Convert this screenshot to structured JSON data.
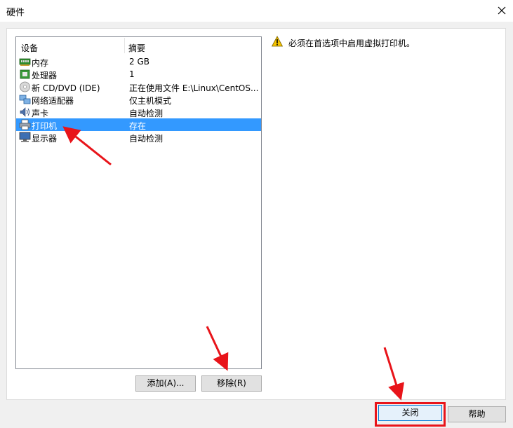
{
  "window": {
    "title": "硬件"
  },
  "device_list": {
    "columns": {
      "device": "设备",
      "summary": "摘要"
    },
    "rows": [
      {
        "name": "内存",
        "summary": "2 GB",
        "icon": "memory-icon",
        "selected": false
      },
      {
        "name": "处理器",
        "summary": "1",
        "icon": "cpu-icon",
        "selected": false
      },
      {
        "name": "新 CD/DVD (IDE)",
        "summary": "正在使用文件 E:\\Linux\\CentOS...",
        "icon": "cd-dvd-icon",
        "selected": false
      },
      {
        "name": "网络适配器",
        "summary": "仅主机模式",
        "icon": "network-adapter-icon",
        "selected": false
      },
      {
        "name": "声卡",
        "summary": "自动检测",
        "icon": "sound-card-icon",
        "selected": false
      },
      {
        "name": "打印机",
        "summary": "存在",
        "icon": "printer-icon",
        "selected": true
      },
      {
        "name": "显示器",
        "summary": "自动检测",
        "icon": "display-icon",
        "selected": false
      }
    ]
  },
  "buttons": {
    "add": "添加(A)...",
    "remove": "移除(R)",
    "close": "关闭",
    "help": "帮助"
  },
  "message": {
    "icon": "warning-icon",
    "text": "必须在首选项中启用虚拟打印机。"
  },
  "colors": {
    "selection": "#3399ff",
    "annotation": "#e8141a",
    "warning": "#f5c400"
  }
}
